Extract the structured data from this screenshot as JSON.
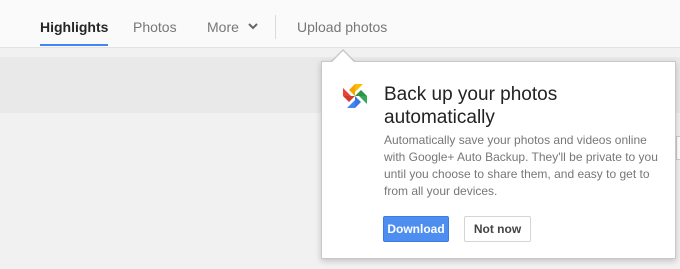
{
  "nav": {
    "highlights": "Highlights",
    "photos": "Photos",
    "more": "More",
    "more_icon": "chevron-down-icon",
    "upload": "Upload photos",
    "active_color": "#4285f4"
  },
  "popup": {
    "icon": "google-photos-pinwheel-icon",
    "title": "Back up your photos automatically",
    "body": "Automatically save your photos and videos online with Google+ Auto Backup. They'll be private to you until you choose to share them, and easy to get to from all your devices.",
    "download_label": "Download",
    "not_now_label": "Not now",
    "download_color": "#4d8ef0"
  }
}
